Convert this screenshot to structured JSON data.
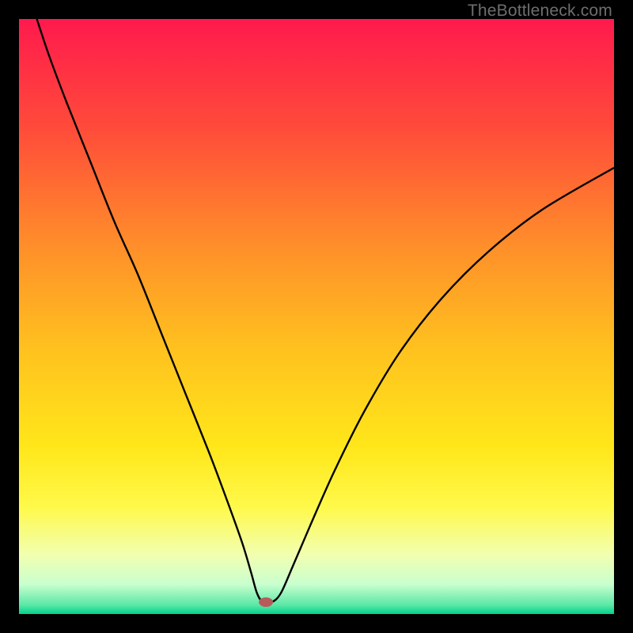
{
  "watermark": "TheBottleneck.com",
  "chart_data": {
    "type": "line",
    "title": "",
    "xlabel": "",
    "ylabel": "",
    "xlim": [
      0,
      100
    ],
    "ylim": [
      0,
      100
    ],
    "grid": false,
    "legend": false,
    "background_gradient": {
      "stops": [
        {
          "offset": 0.0,
          "color": "#ff1a4d"
        },
        {
          "offset": 0.18,
          "color": "#ff4a3a"
        },
        {
          "offset": 0.38,
          "color": "#ff8e2a"
        },
        {
          "offset": 0.55,
          "color": "#ffc01f"
        },
        {
          "offset": 0.72,
          "color": "#ffe71a"
        },
        {
          "offset": 0.82,
          "color": "#fff94a"
        },
        {
          "offset": 0.9,
          "color": "#f2ffb0"
        },
        {
          "offset": 0.95,
          "color": "#c9ffcf"
        },
        {
          "offset": 0.985,
          "color": "#5be7a6"
        },
        {
          "offset": 1.0,
          "color": "#00d38d"
        }
      ]
    },
    "marker": {
      "x": 41.5,
      "y": 2.0,
      "color": "#b85a5a",
      "rx": 9,
      "ry": 6
    },
    "series": [
      {
        "name": "curve",
        "color": "#000000",
        "width": 2.4,
        "x": [
          3,
          5,
          8,
          12,
          16,
          20,
          24,
          28,
          32,
          35,
          37.5,
          39,
          40,
          41,
          42.5,
          44,
          46,
          49,
          53,
          58,
          64,
          71,
          79,
          88,
          100
        ],
        "y": [
          100,
          94,
          86,
          76,
          66,
          57,
          47,
          37,
          27,
          19,
          12,
          7,
          3.5,
          2,
          2,
          3.5,
          8,
          15,
          24,
          34,
          44,
          53,
          61,
          68,
          75
        ]
      }
    ]
  }
}
